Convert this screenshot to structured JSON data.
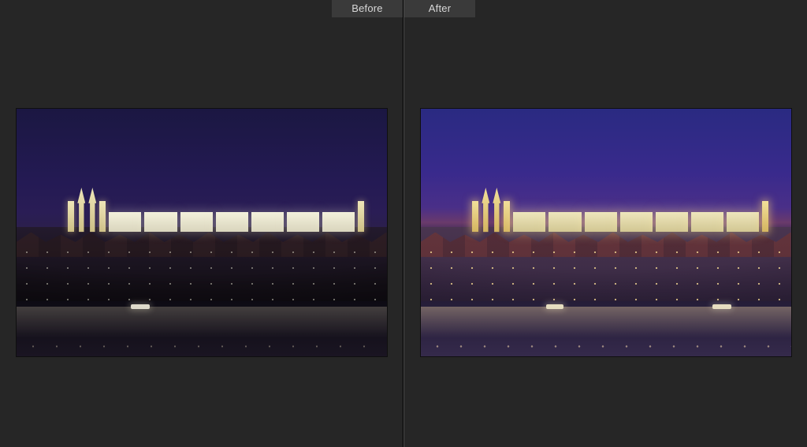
{
  "compare": {
    "before_label": "Before",
    "after_label": "After"
  }
}
